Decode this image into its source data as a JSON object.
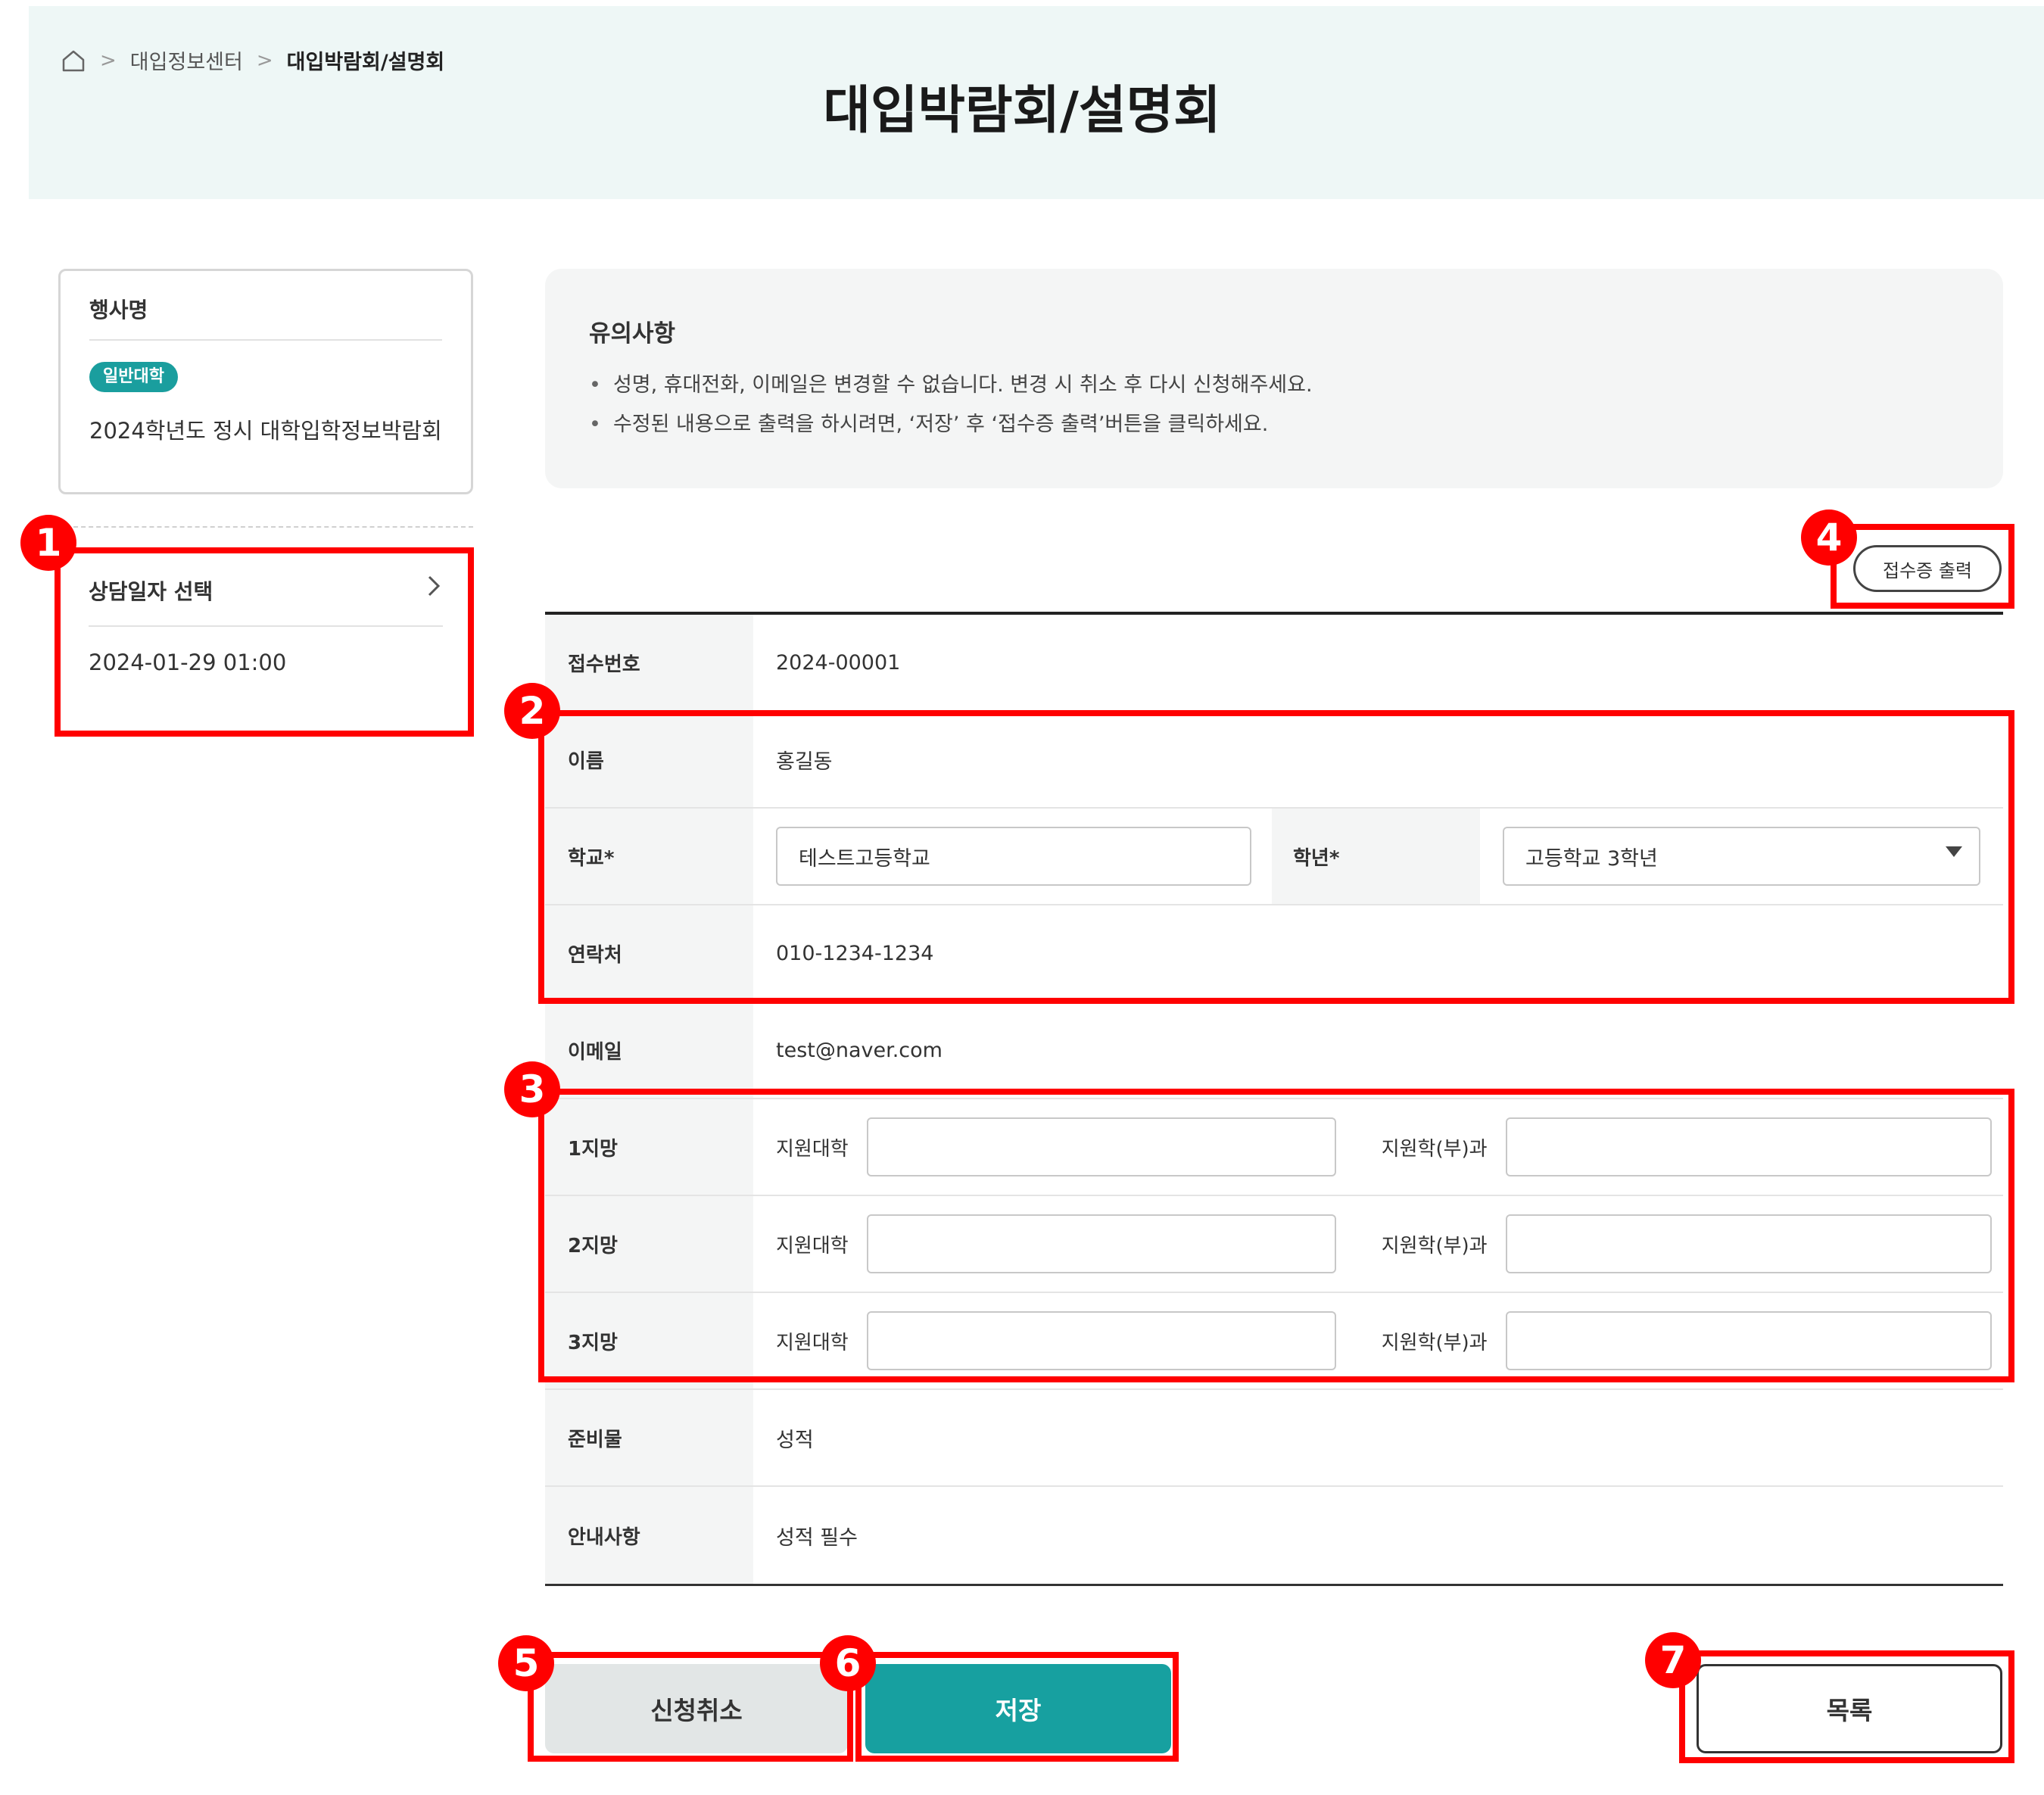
{
  "breadcrumb": {
    "items": [
      "대입정보센터",
      "대입박람회/설명회"
    ]
  },
  "page": {
    "title": "대입박람회/설명회"
  },
  "event_card": {
    "label": "행사명",
    "badge": "일반대학",
    "event_name": "2024학년도 정시 대학입학정보박람회"
  },
  "date_select": {
    "label": "상담일자 선택",
    "value": "2024-01-29 01:00"
  },
  "notice": {
    "title": "유의사항",
    "items": [
      "성명, 휴대전화, 이메일은 변경할 수 없습니다. 변경 시 취소 후 다시 신청해주세요.",
      "수정된 내용으로 출력을 하시려면, ‘저장’ 후 ‘접수증 출력’버튼을 클릭하세요."
    ]
  },
  "print_button": {
    "label": "접수증 출력"
  },
  "form": {
    "receipt_no": {
      "label": "접수번호",
      "value": "2024-00001"
    },
    "name": {
      "label": "이름",
      "value": "홍길동"
    },
    "school": {
      "label": "학교*",
      "value": "테스트고등학교"
    },
    "grade": {
      "label": "학년*",
      "value": "고등학교 3학년"
    },
    "phone": {
      "label": "연락처",
      "value": "010-1234-1234"
    },
    "email": {
      "label": "이메일",
      "value": "test@naver.com"
    },
    "choices": [
      {
        "label": "1지망",
        "univ_label": "지원대학",
        "dept_label": "지원학(부)과",
        "univ_value": "",
        "dept_value": ""
      },
      {
        "label": "2지망",
        "univ_label": "지원대학",
        "dept_label": "지원학(부)과",
        "univ_value": "",
        "dept_value": ""
      },
      {
        "label": "3지망",
        "univ_label": "지원대학",
        "dept_label": "지원학(부)과",
        "univ_value": "",
        "dept_value": ""
      }
    ],
    "preparation": {
      "label": "준비물",
      "value": "성적"
    },
    "guide": {
      "label": "안내사항",
      "value": "성적 필수"
    }
  },
  "buttons": {
    "cancel": "신청취소",
    "save": "저장",
    "list": "목록"
  },
  "annotations": [
    "1",
    "2",
    "3",
    "4",
    "5",
    "6",
    "7"
  ],
  "colors": {
    "accent": "#17a0a0",
    "header_bg": "#eef7f6",
    "highlight": "#ff0000"
  }
}
